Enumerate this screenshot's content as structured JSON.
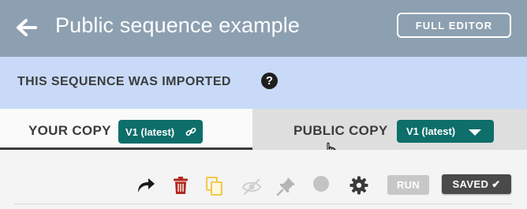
{
  "header": {
    "title": "Public sequence example",
    "full_editor_label": "FULL EDITOR"
  },
  "banner": {
    "text": "THIS SEQUENCE WAS IMPORTED",
    "help_glyph": "?"
  },
  "tabs": [
    {
      "label": "YOUR COPY",
      "version": "V1 (latest)",
      "icon": "link-icon",
      "active": true
    },
    {
      "label": "PUBLIC COPY",
      "version": "V1 (latest)",
      "icon": "chevron-down-icon",
      "active": false
    }
  ],
  "toolbar": {
    "icons": [
      "share-icon",
      "trash-icon",
      "copy-icon",
      "hidden-eye-icon",
      "pin-icon",
      "color-circle-icon",
      "gear-icon"
    ],
    "run_label": "RUN",
    "saved_label": "SAVED",
    "saved_check": "✔"
  },
  "colors": {
    "header_bg": "#8da0b1",
    "banner_bg": "#c8daf7",
    "badge_teal": "#0d6e6a",
    "trash_red": "#b3261e",
    "copy_yellow": "#f2c94c"
  }
}
